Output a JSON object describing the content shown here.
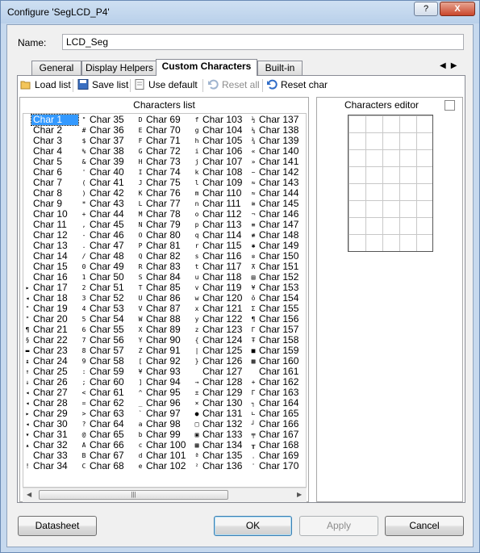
{
  "window": {
    "title": "Configure 'SegLCD_P4'",
    "help_label": "?",
    "close_label": "X"
  },
  "name_field": {
    "label": "Name:",
    "value": "LCD_Seg"
  },
  "tabs": [
    {
      "label": "General",
      "active": false
    },
    {
      "label": "Display Helpers",
      "active": false
    },
    {
      "label": "Custom Characters",
      "active": true
    },
    {
      "label": "Built-in",
      "active": false
    }
  ],
  "tab_scroll": {
    "left_icon": "left-arrow-icon",
    "right_icon": "right-arrow-icon"
  },
  "toolbar": {
    "load_list": "Load list",
    "save_list": "Save list",
    "use_default": "Use default",
    "reset_all": "Reset all",
    "reset_char": "Reset char"
  },
  "characters_list": {
    "title": "Characters list",
    "selected": "Char 1",
    "columns": [
      {
        "items": [
          {
            "g": "",
            "l": "Char 1"
          },
          {
            "g": "",
            "l": "Char 2"
          },
          {
            "g": "",
            "l": "Char 3"
          },
          {
            "g": "",
            "l": "Char 4"
          },
          {
            "g": "",
            "l": "Char 5"
          },
          {
            "g": "",
            "l": "Char 6"
          },
          {
            "g": "",
            "l": "Char 7"
          },
          {
            "g": "",
            "l": "Char 8"
          },
          {
            "g": "",
            "l": "Char 9"
          },
          {
            "g": "",
            "l": "Char 10"
          },
          {
            "g": "",
            "l": "Char 11"
          },
          {
            "g": "",
            "l": "Char 12"
          },
          {
            "g": "",
            "l": "Char 13"
          },
          {
            "g": "",
            "l": "Char 14"
          },
          {
            "g": "",
            "l": "Char 15"
          },
          {
            "g": "",
            "l": "Char 16"
          },
          {
            "g": "▸",
            "l": "Char 17"
          },
          {
            "g": "◂",
            "l": "Char 18"
          },
          {
            "g": "\"",
            "l": "Char 19"
          },
          {
            "g": "\"",
            "l": "Char 20"
          },
          {
            "g": "¶",
            "l": "Char 21"
          },
          {
            "g": "§",
            "l": "Char 22"
          },
          {
            "g": "▬",
            "l": "Char 23"
          },
          {
            "g": "↨",
            "l": "Char 24"
          },
          {
            "g": "↑",
            "l": "Char 25"
          },
          {
            "g": "↓",
            "l": "Char 26"
          },
          {
            "g": "◂",
            "l": "Char 27"
          },
          {
            "g": "◂",
            "l": "Char 28"
          },
          {
            "g": "▸",
            "l": "Char 29"
          },
          {
            "g": "◂",
            "l": "Char 30"
          },
          {
            "g": "▾",
            "l": "Char 31"
          },
          {
            "g": "▴",
            "l": "Char 32"
          },
          {
            "g": "",
            "l": "Char 33"
          },
          {
            "g": "!",
            "l": "Char 34"
          }
        ]
      },
      {
        "items": [
          {
            "g": "\"",
            "l": "Char 35"
          },
          {
            "g": "#",
            "l": "Char 36"
          },
          {
            "g": "$",
            "l": "Char 37"
          },
          {
            "g": "%",
            "l": "Char 38"
          },
          {
            "g": "&",
            "l": "Char 39"
          },
          {
            "g": "'",
            "l": "Char 40"
          },
          {
            "g": "(",
            "l": "Char 41"
          },
          {
            "g": ")",
            "l": "Char 42"
          },
          {
            "g": "*",
            "l": "Char 43"
          },
          {
            "g": "+",
            "l": "Char 44"
          },
          {
            "g": ",",
            "l": "Char 45"
          },
          {
            "g": "-",
            "l": "Char 46"
          },
          {
            "g": ".",
            "l": "Char 47"
          },
          {
            "g": "/",
            "l": "Char 48"
          },
          {
            "g": "0",
            "l": "Char 49"
          },
          {
            "g": "1",
            "l": "Char 50"
          },
          {
            "g": "2",
            "l": "Char 51"
          },
          {
            "g": "3",
            "l": "Char 52"
          },
          {
            "g": "4",
            "l": "Char 53"
          },
          {
            "g": "5",
            "l": "Char 54"
          },
          {
            "g": "6",
            "l": "Char 55"
          },
          {
            "g": "7",
            "l": "Char 56"
          },
          {
            "g": "8",
            "l": "Char 57"
          },
          {
            "g": "9",
            "l": "Char 58"
          },
          {
            "g": ":",
            "l": "Char 59"
          },
          {
            "g": ";",
            "l": "Char 60"
          },
          {
            "g": "<",
            "l": "Char 61"
          },
          {
            "g": "=",
            "l": "Char 62"
          },
          {
            "g": ">",
            "l": "Char 63"
          },
          {
            "g": "?",
            "l": "Char 64"
          },
          {
            "g": "@",
            "l": "Char 65"
          },
          {
            "g": "A",
            "l": "Char 66"
          },
          {
            "g": "B",
            "l": "Char 67"
          },
          {
            "g": "C",
            "l": "Char 68"
          }
        ]
      },
      {
        "items": [
          {
            "g": "D",
            "l": "Char 69"
          },
          {
            "g": "E",
            "l": "Char 70"
          },
          {
            "g": "F",
            "l": "Char 71"
          },
          {
            "g": "G",
            "l": "Char 72"
          },
          {
            "g": "H",
            "l": "Char 73"
          },
          {
            "g": "I",
            "l": "Char 74"
          },
          {
            "g": "J",
            "l": "Char 75"
          },
          {
            "g": "K",
            "l": "Char 76"
          },
          {
            "g": "L",
            "l": "Char 77"
          },
          {
            "g": "M",
            "l": "Char 78"
          },
          {
            "g": "N",
            "l": "Char 79"
          },
          {
            "g": "O",
            "l": "Char 80"
          },
          {
            "g": "P",
            "l": "Char 81"
          },
          {
            "g": "Q",
            "l": "Char 82"
          },
          {
            "g": "R",
            "l": "Char 83"
          },
          {
            "g": "S",
            "l": "Char 84"
          },
          {
            "g": "T",
            "l": "Char 85"
          },
          {
            "g": "U",
            "l": "Char 86"
          },
          {
            "g": "V",
            "l": "Char 87"
          },
          {
            "g": "W",
            "l": "Char 88"
          },
          {
            "g": "X",
            "l": "Char 89"
          },
          {
            "g": "Y",
            "l": "Char 90"
          },
          {
            "g": "Z",
            "l": "Char 91"
          },
          {
            "g": "[",
            "l": "Char 92"
          },
          {
            "g": "¥",
            "l": "Char 93"
          },
          {
            "g": "]",
            "l": "Char 94"
          },
          {
            "g": "^",
            "l": "Char 95"
          },
          {
            "g": "_",
            "l": "Char 96"
          },
          {
            "g": "`",
            "l": "Char 97"
          },
          {
            "g": "a",
            "l": "Char 98"
          },
          {
            "g": "b",
            "l": "Char 99"
          },
          {
            "g": "c",
            "l": "Char 100"
          },
          {
            "g": "d",
            "l": "Char 101"
          },
          {
            "g": "e",
            "l": "Char 102"
          }
        ]
      },
      {
        "items": [
          {
            "g": "f",
            "l": "Char 103"
          },
          {
            "g": "g",
            "l": "Char 104"
          },
          {
            "g": "h",
            "l": "Char 105"
          },
          {
            "g": "i",
            "l": "Char 106"
          },
          {
            "g": "j",
            "l": "Char 107"
          },
          {
            "g": "k",
            "l": "Char 108"
          },
          {
            "g": "l",
            "l": "Char 109"
          },
          {
            "g": "m",
            "l": "Char 110"
          },
          {
            "g": "n",
            "l": "Char 111"
          },
          {
            "g": "o",
            "l": "Char 112"
          },
          {
            "g": "p",
            "l": "Char 113"
          },
          {
            "g": "q",
            "l": "Char 114"
          },
          {
            "g": "r",
            "l": "Char 115"
          },
          {
            "g": "s",
            "l": "Char 116"
          },
          {
            "g": "t",
            "l": "Char 117"
          },
          {
            "g": "u",
            "l": "Char 118"
          },
          {
            "g": "v",
            "l": "Char 119"
          },
          {
            "g": "w",
            "l": "Char 120"
          },
          {
            "g": "x",
            "l": "Char 121"
          },
          {
            "g": "y",
            "l": "Char 122"
          },
          {
            "g": "z",
            "l": "Char 123"
          },
          {
            "g": "{",
            "l": "Char 124"
          },
          {
            "g": "|",
            "l": "Char 125"
          },
          {
            "g": "}",
            "l": "Char 126"
          },
          {
            "g": "",
            "l": "Char 127"
          },
          {
            "g": "→",
            "l": "Char 128"
          },
          {
            "g": "±",
            "l": "Char 129"
          },
          {
            "g": "×",
            "l": "Char 130"
          },
          {
            "g": "●",
            "l": "Char 131"
          },
          {
            "g": "□",
            "l": "Char 132"
          },
          {
            "g": "▣",
            "l": "Char 133"
          },
          {
            "g": "▦",
            "l": "Char 134"
          },
          {
            "g": "ª",
            "l": "Char 135"
          },
          {
            "g": "²",
            "l": "Char 136"
          }
        ]
      },
      {
        "items": [
          {
            "g": "½",
            "l": "Char 137"
          },
          {
            "g": "¼",
            "l": "Char 138"
          },
          {
            "g": "¾",
            "l": "Char 139"
          },
          {
            "g": "«",
            "l": "Char 140"
          },
          {
            "g": "»",
            "l": "Char 141"
          },
          {
            "g": "~",
            "l": "Char 142"
          },
          {
            "g": "≈",
            "l": "Char 143"
          },
          {
            "g": "≈",
            "l": "Char 144"
          },
          {
            "g": "≅",
            "l": "Char 145"
          },
          {
            "g": "¬",
            "l": "Char 146"
          },
          {
            "g": "≡",
            "l": "Char 147"
          },
          {
            "g": "≢",
            "l": "Char 148"
          },
          {
            "g": "✱",
            "l": "Char 149"
          },
          {
            "g": "✲",
            "l": "Char 150"
          },
          {
            "g": "⊼",
            "l": "Char 151"
          },
          {
            "g": "▤",
            "l": "Char 152"
          },
          {
            "g": "¥",
            "l": "Char 153"
          },
          {
            "g": "ǒ",
            "l": "Char 154"
          },
          {
            "g": "Σ",
            "l": "Char 155"
          },
          {
            "g": "¶",
            "l": "Char 156"
          },
          {
            "g": "Γ",
            "l": "Char 157"
          },
          {
            "g": "Ŧ",
            "l": "Char 158"
          },
          {
            "g": "■",
            "l": "Char 159"
          },
          {
            "g": "▩",
            "l": "Char 160"
          },
          {
            "g": "",
            "l": "Char 161"
          },
          {
            "g": "+",
            "l": "Char 162"
          },
          {
            "g": "Γ",
            "l": "Char 163"
          },
          {
            "g": "┐",
            "l": "Char 164"
          },
          {
            "g": "∟",
            "l": "Char 165"
          },
          {
            "g": "┘",
            "l": "Char 166"
          },
          {
            "g": "╤",
            "l": "Char 167"
          },
          {
            "g": "╥",
            "l": "Char 168"
          },
          {
            "g": "ˌ",
            "l": "Char 169"
          },
          {
            "g": "ˈ",
            "l": "Char 170"
          }
        ]
      }
    ]
  },
  "characters_editor": {
    "title": "Characters editor",
    "grid_rows": 8,
    "grid_cols": 5
  },
  "buttons": {
    "datasheet": "Datasheet",
    "ok": "OK",
    "apply": "Apply",
    "cancel": "Cancel"
  },
  "colors": {
    "selection": "#3399ff",
    "title_bar": "#c6d9ee",
    "close_button": "#c9462b"
  }
}
